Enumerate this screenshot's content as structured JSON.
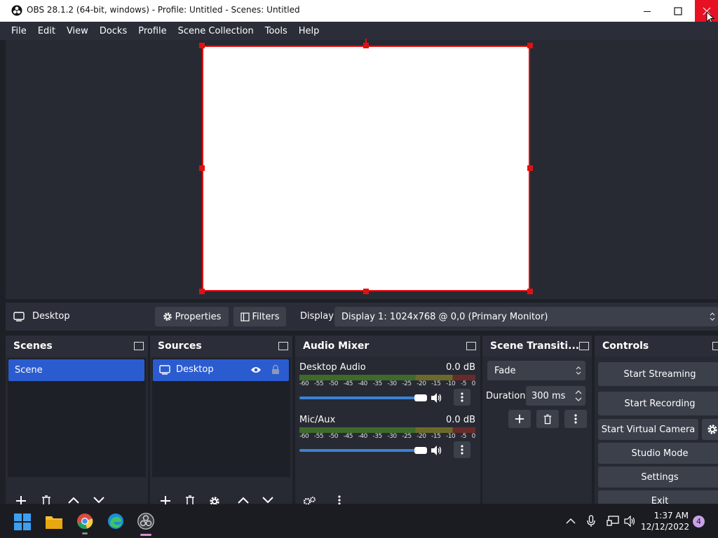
{
  "window": {
    "title": "OBS 28.1.2 (64-bit, windows) - Profile: Untitled - Scenes: Untitled"
  },
  "menu": [
    "File",
    "Edit",
    "View",
    "Docks",
    "Profile",
    "Scene Collection",
    "Tools",
    "Help"
  ],
  "source_bar": {
    "selected_source": "Desktop",
    "properties_label": "Properties",
    "filters_label": "Filters",
    "display_label": "Display",
    "display_value": "Display 1: 1024x768 @ 0,0 (Primary Monitor)"
  },
  "scenes": {
    "title": "Scenes",
    "items": [
      "Scene"
    ]
  },
  "sources": {
    "title": "Sources",
    "items": [
      "Desktop"
    ]
  },
  "audio_mixer": {
    "title": "Audio Mixer",
    "ticks": [
      "-60",
      "-55",
      "-50",
      "-45",
      "-40",
      "-35",
      "-30",
      "-25",
      "-20",
      "-15",
      "-10",
      "-5",
      "0"
    ],
    "channels": [
      {
        "name": "Desktop Audio",
        "db": "0.0 dB"
      },
      {
        "name": "Mic/Aux",
        "db": "0.0 dB"
      }
    ]
  },
  "transitions": {
    "title": "Scene Transiti...",
    "selected": "Fade",
    "duration_label": "Duration",
    "duration_value": "300 ms"
  },
  "controls": {
    "title": "Controls",
    "start_streaming": "Start Streaming",
    "start_recording": "Start Recording",
    "start_virtual_camera": "Start Virtual Camera",
    "studio_mode": "Studio Mode",
    "settings": "Settings",
    "exit": "Exit"
  },
  "taskbar": {
    "time": "1:37 AM",
    "date": "12/12/2022",
    "notifications": "4"
  },
  "colors": {
    "accent": "#2b5ccf",
    "selection_border": "#e01111",
    "panel_bg": "#272a33"
  }
}
